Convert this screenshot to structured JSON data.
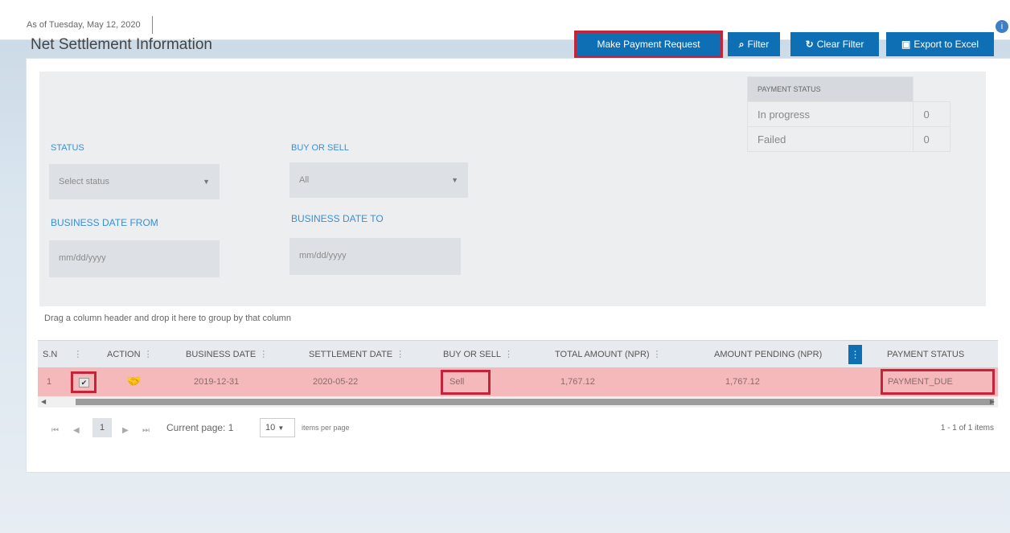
{
  "topbar": {
    "as_of": "As of Tuesday, May 12, 2020",
    "help_icon": "info-icon"
  },
  "panel": {
    "title": "Net Settlement Information",
    "buttons": {
      "make_payment": "Make Payment Request",
      "filter": "Filter",
      "clear_filter": "Clear Filter",
      "export": "Export to Excel"
    },
    "icons": {
      "filter": "search-icon",
      "clear_filter": "refresh-icon",
      "export": "excel-icon"
    },
    "filters": {
      "status_label": "STATUS",
      "status_value": "Select status",
      "buy_sell_label": "BUY OR SELL",
      "buy_sell_value": "All",
      "date_from_label": "BUSINESS DATE FROM",
      "date_from_placeholder": "mm/dd/yyyy",
      "date_to_label": "BUSINESS DATE TO",
      "date_to_placeholder": "mm/dd/yyyy"
    },
    "payment_status": {
      "header": "PAYMENT STATUS",
      "rows": [
        {
          "label": "In progress",
          "count": "0"
        },
        {
          "label": "Failed",
          "count": "0"
        }
      ]
    }
  },
  "grid": {
    "group_hint": "Drag a column header and drop it here to group by that column",
    "columns": [
      "S.N",
      "ACTION",
      "BUSINESS DATE",
      "SETTLEMENT DATE",
      "BUY OR SELL",
      "TOTAL AMOUNT (NPR)",
      "AMOUNT PENDING (NPR)",
      "PAYMENT STATUS"
    ],
    "rows": [
      {
        "sn": "1",
        "business_date": "2019-12-31",
        "settlement_date": "2020-05-22",
        "buy_or_sell": "Sell",
        "total_amount": "1,767.12",
        "amount_pending": "1,767.12",
        "payment_status": "PAYMENT_DUE"
      }
    ],
    "pager": {
      "current_page_number": "1",
      "current_page_text": "Current page: 1",
      "page_size": "10",
      "items_per_page": "items per page",
      "summary": "1 - 1 of 1 items"
    }
  },
  "colors": {
    "primary_button": "#0f6fb4",
    "highlight_border": "#c4233a",
    "row_highlight": "#f5b9bc",
    "label_blue": "#3a8fd6"
  }
}
